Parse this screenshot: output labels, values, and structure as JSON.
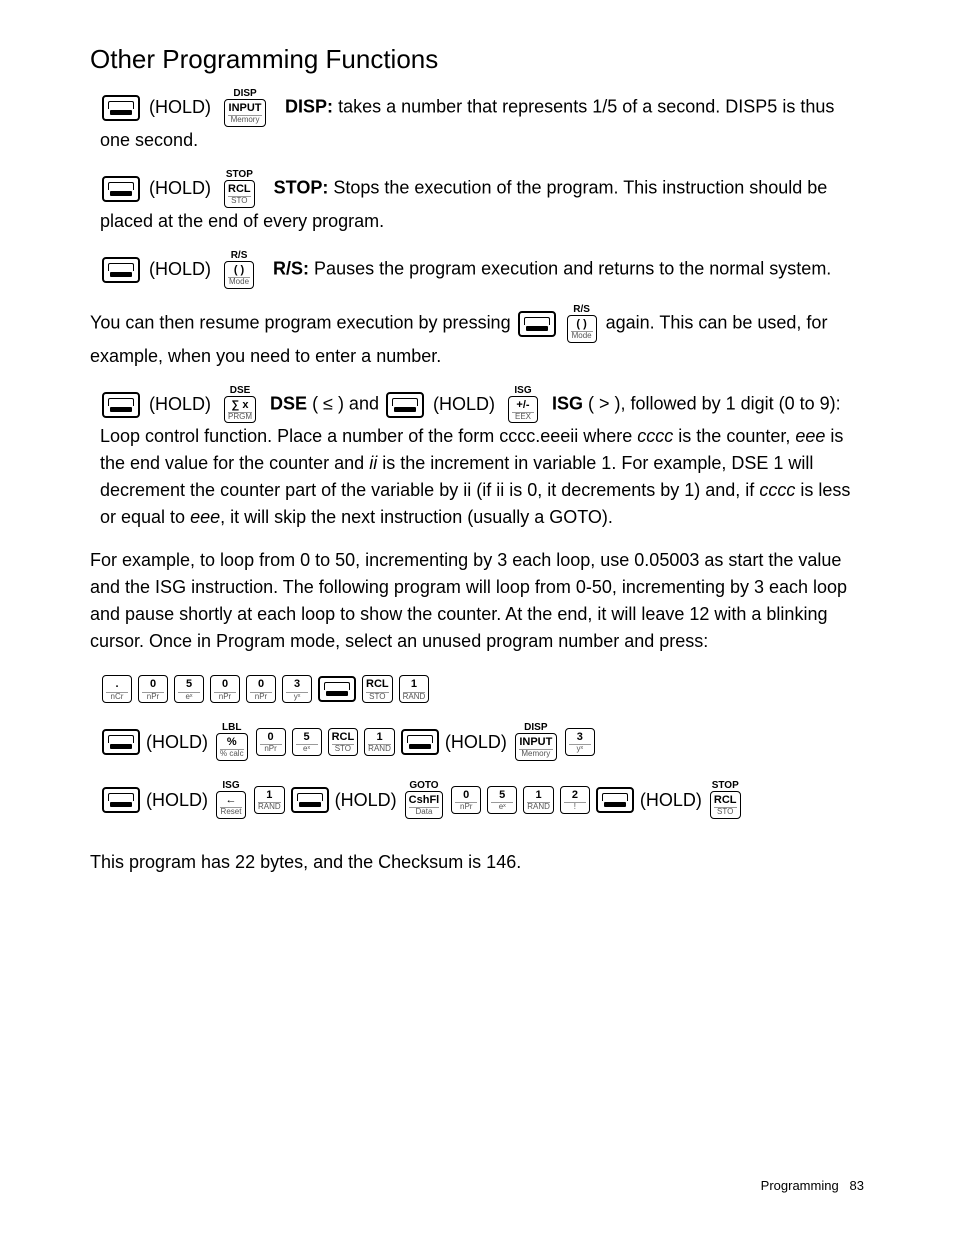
{
  "title": "Other Programming Functions",
  "hold": "(HOLD)",
  "keys": {
    "disp_above": "DISP",
    "input_top": "INPUT",
    "input_bot": "Memory",
    "stop_above": "STOP",
    "rcl_top": "RCL",
    "rcl_bot": "STO",
    "rs_above": "R/S",
    "paren_top": "( )",
    "paren_bot": "Mode",
    "dse_above": "DSE",
    "dse_top": "∑ x",
    "dse_bot": "PRGM",
    "isg_above": "ISG",
    "isg_top": "+/-",
    "isg_bot": "EEX",
    "lbl_above": "LBL",
    "lbl_top": "%",
    "lbl_bot": "% calc",
    "goto_above": "GOTO",
    "goto_top": "CshFl",
    "goto_bot": "Data",
    "reset_top": "←",
    "reset_bot": "Reset",
    "dot_top": ".",
    "dot_bot": "nCr",
    "n0_top": "0",
    "n0_bot": "nPr",
    "n1_top": "1",
    "n1_bot": "RAND",
    "n2_top": "2",
    "n2_bot": "!",
    "n3_top": "3",
    "n3_bot": "yˣ",
    "n5_top": "5",
    "n5_bot": "eˣ"
  },
  "para": {
    "disp1": "DISP:",
    "disp2": " takes a number that represents 1/5 of a second. DISP5 is thus one second.",
    "stop1": "STOP:",
    "stop2": " Stops the execution of the program. This instruction should be placed at the end of every program.",
    "rs1": "R/S:",
    "rs2": " Pauses the program execution and returns to the normal system.",
    "rs3a": "You can then resume program execution by pressing ",
    "rs3b": " again. This can be used, for example, when you need to enter a number.",
    "dse_bold": "DSE",
    "dse_txt1": " ( ≤ ) and ",
    "isg_bold": "ISG",
    "isg_txt1": " ( > ), followed by 1 digit (0 to 9): Loop control function. Place a number of the form cccc.eeeii where ",
    "cccc": "cccc",
    "isg_txt2": " is the counter, ",
    "eee": "eee",
    "isg_txt3": " is the end value for the counter and ",
    "ii": "ii",
    "isg_txt4": " is the increment in variable 1. For example, DSE 1 will decrement the counter part of the variable by ii (if ii is 0, it decrements by 1) and, if ",
    "isg_txt5": " is less or equal to ",
    "isg_txt6": ", it will skip the next instruction (usually a GOTO).",
    "example": "For example, to loop from 0 to 50, incrementing by 3 each loop, use 0.05003 as start the value and the ISG instruction. The following program will loop from 0-50, incrementing by 3 each loop and pause shortly at each loop to show the counter. At the end, it will leave 12 with a blinking cursor. Once in Program mode, select an unused program number and press:",
    "checksum": "This program has 22 bytes, and the Checksum is 146."
  },
  "footer": {
    "section": "Programming",
    "page": "83"
  }
}
